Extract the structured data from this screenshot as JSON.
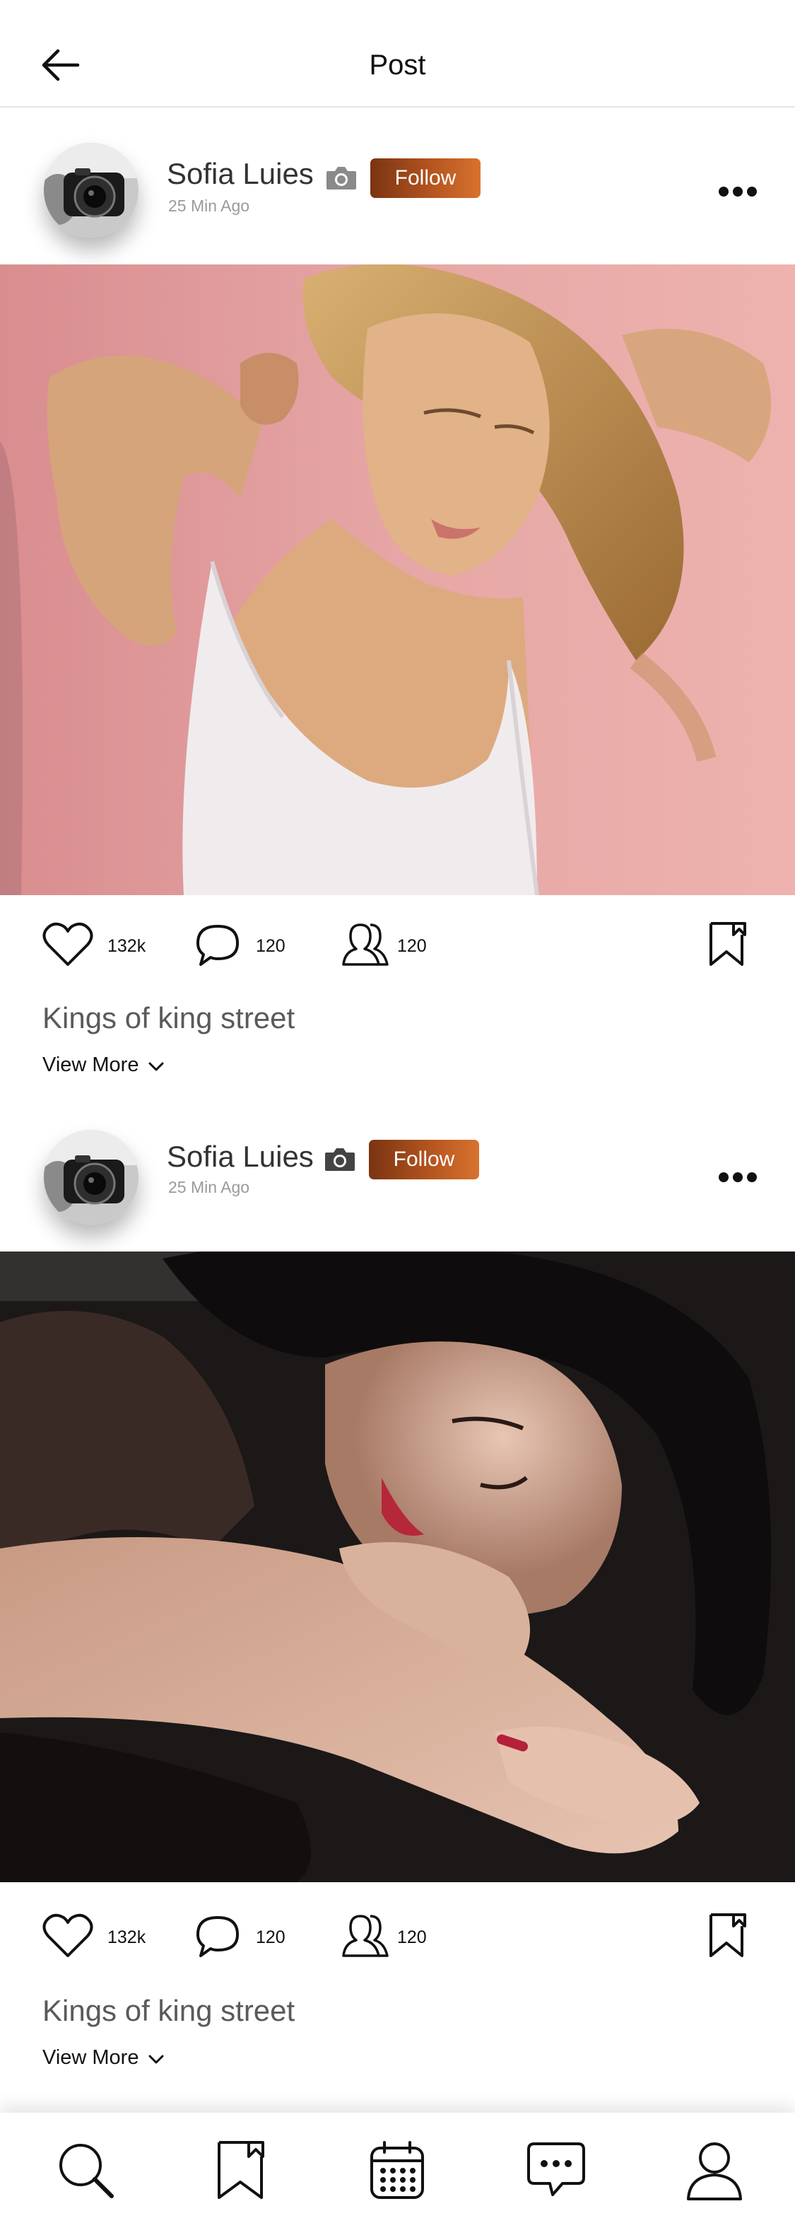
{
  "header": {
    "title": "Post"
  },
  "posts": [
    {
      "username": "Sofia Luies",
      "follow_label": "Follow",
      "time": "25 Min Ago",
      "likes": "132k",
      "comments": "120",
      "shares": "120",
      "caption": "Kings of king street",
      "view_more": "View More"
    },
    {
      "username": "Sofia Luies",
      "follow_label": "Follow",
      "time": "25 Min Ago",
      "likes": "132k",
      "comments": "120",
      "shares": "120",
      "caption": "Kings of king street",
      "view_more": "View More"
    }
  ],
  "bottom_nav": {
    "items": [
      "search-icon",
      "bookmark-icon",
      "calendar-icon",
      "chat-icon",
      "profile-icon"
    ]
  },
  "colors": {
    "follow_start": "#7a3412",
    "follow_end": "#d8722e",
    "photo1_bg": "#e3a09e",
    "photo2_bg": "#1c1818"
  }
}
